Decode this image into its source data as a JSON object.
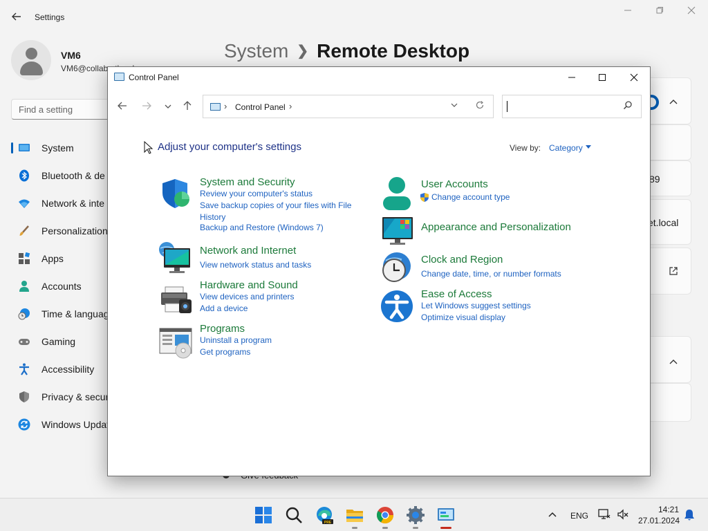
{
  "settings": {
    "app_title": "Settings",
    "user": {
      "name": "VM6",
      "email": "VM6@collab...tlocal"
    },
    "search_placeholder": "Find a setting",
    "breadcrumb": {
      "parent": "System",
      "current": "Remote Desktop"
    },
    "nav_items": [
      {
        "label": "System",
        "icon": "system-icon"
      },
      {
        "label": "Bluetooth & de",
        "icon": "bluetooth-icon"
      },
      {
        "label": "Network & inte",
        "icon": "network-icon"
      },
      {
        "label": "Personalization",
        "icon": "brush-icon"
      },
      {
        "label": "Apps",
        "icon": "apps-icon"
      },
      {
        "label": "Accounts",
        "icon": "accounts-icon"
      },
      {
        "label": "Time & languag",
        "icon": "time-icon"
      },
      {
        "label": "Gaming",
        "icon": "gamepad-icon"
      },
      {
        "label": "Accessibility",
        "icon": "accessibility-icon"
      },
      {
        "label": "Privacy & secur",
        "icon": "shield-icon"
      },
      {
        "label": "Windows Updat",
        "icon": "update-icon"
      }
    ],
    "card_texts": {
      "port": "89",
      "domain": "et.local"
    },
    "feedback": "Give feedback"
  },
  "control_panel": {
    "window_title": "Control Panel",
    "address": "Control Panel",
    "heading": "Adjust your computer's settings",
    "view_by_label": "View by:",
    "view_by_value": "Category",
    "categories": {
      "system_security": {
        "title": "System and Security",
        "links": [
          "Review your computer's status",
          "Save backup copies of your files with File",
          "History",
          "Backup and Restore (Windows 7)"
        ]
      },
      "network_internet": {
        "title": "Network and Internet",
        "links": [
          "View network status and tasks"
        ]
      },
      "hardware_sound": {
        "title": "Hardware and Sound",
        "links": [
          "View devices and printers",
          "Add a device"
        ]
      },
      "programs": {
        "title": "Programs",
        "links": [
          "Uninstall a program",
          "Get programs"
        ]
      },
      "user_accounts": {
        "title": "User Accounts",
        "links": [
          "Change account type"
        ]
      },
      "appearance": {
        "title": "Appearance and Personalization",
        "links": []
      },
      "clock_region": {
        "title": "Clock and Region",
        "links": [
          "Change date, time, or number formats"
        ]
      },
      "ease_access": {
        "title": "Ease of Access",
        "links": [
          "Let Windows suggest settings",
          "Optimize visual display"
        ]
      }
    }
  },
  "taskbar": {
    "apps": [
      "start-icon",
      "search-icon",
      "edge-dev-icon",
      "file-explorer-icon",
      "chrome-icon",
      "settings-icon",
      "control-panel-icon"
    ],
    "language": "ENG",
    "time": "14:21",
    "date": "27.01.2024"
  }
}
